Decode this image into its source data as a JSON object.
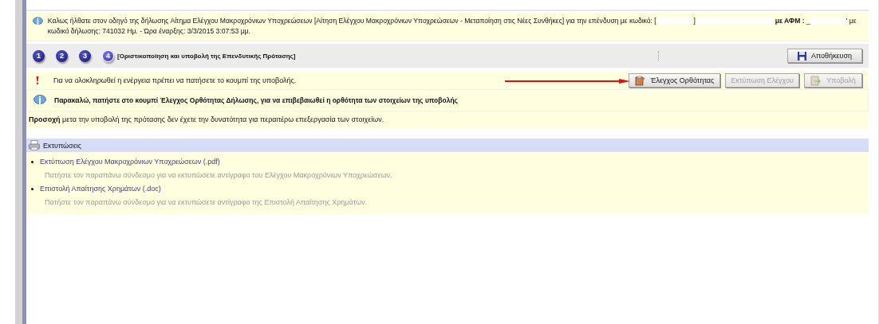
{
  "welcome": {
    "text": "Καλως ήλθατε στον οδηγό της δήλωσης Αίτημα Ελέγχου Μακροχρόνιων Υποχρεώσεων [Αίτηση Ελέγχου Μακροχρόνιων Υποχρεώσεων - Μεταποίηση στις Νέες Συνθήκες] για την επένδυση με κωδικό: [",
    "after_code": "]",
    "afm_label": "με ΑΦΜ :",
    "afm_prefix": "_",
    "tail": "' με κωδικό δήλωσης: 741032 Ημ. - Ώρα έναρξης: 3/3/2015 3:07:53 μμ."
  },
  "steps": [
    {
      "label": "1",
      "selected": false
    },
    {
      "label": "2",
      "selected": false
    },
    {
      "label": "3",
      "selected": false
    },
    {
      "label": "4",
      "selected": true
    }
  ],
  "step_title": "[Οριστικοποίηση και υποβολή της Επενδυτικής Πρότασης]",
  "save_button": "Αποθήκευση",
  "notice": "Για να ολοκληρωθεί η ενέργεια πρέπει να πατήσετε το κουμπί της υποβολής.",
  "actions": [
    {
      "label": "Έλεγχος Ορθότητας",
      "disabled": false,
      "kind": "check"
    },
    {
      "label": "Εκτύπωση Ελέγχου",
      "disabled": true,
      "kind": "print"
    },
    {
      "label": "Υποβολή",
      "disabled": true,
      "kind": "submit"
    }
  ],
  "info": "Παρακαλώ, πατήστε στο κουμπί Έλεγχος Ορθότητας Δήλωσης, για να επιβεβαιωθεί η ορθότητα των στοιχείων της υποβολής",
  "warning": "**Προσοχή** μετα την υποβολή της πρότασης δεν έχετε την δυνατότητα για περαιτέρω επεξεργασία των στοιχείων.",
  "prints": {
    "title": "Εκτυπώσεις",
    "items": [
      {
        "link": "Εκτύπωση Ελέγχου Μακροχρόνιων Υποχρεώσεων (.pdf)",
        "description": "Πατήστε τον παραπάνω σύνδεσμο για να εκτυπώσετε αντίγραφο του Ελέγχου Μακροχρόνιων Υποχρεώσεων."
      },
      {
        "link": "Επιστολή Απαίτησης Χρημάτων (.doc)",
        "description": "Πατήστε τον παραπάνω σύνδεσμο για να εκτυπώσετε αντίγραφο της Επιστολή Απαίτησης Χρημάτων."
      }
    ]
  }
}
